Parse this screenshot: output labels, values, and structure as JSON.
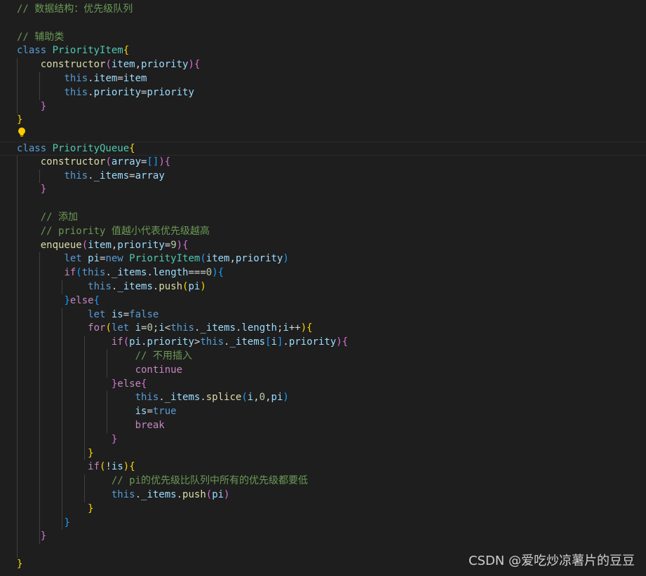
{
  "watermark": "CSDN @爱吃炒凉薯片的豆豆",
  "lines": [
    [
      {
        "t": "// 数据结构：优先级队列",
        "c": "com"
      }
    ],
    [],
    [
      {
        "t": "// 辅助类",
        "c": "com"
      }
    ],
    [
      {
        "t": "class ",
        "c": "kw"
      },
      {
        "t": "PriorityItem",
        "c": "cls"
      },
      {
        "t": "{",
        "c": "b1"
      }
    ],
    [
      {
        "t": "    "
      },
      {
        "t": "constructor",
        "c": "fn"
      },
      {
        "t": "(",
        "c": "b2"
      },
      {
        "t": "item",
        "c": "var"
      },
      {
        "t": ",",
        "c": "op"
      },
      {
        "t": "priority",
        "c": "var"
      },
      {
        "t": ")",
        "c": "b2"
      },
      {
        "t": "{",
        "c": "b2"
      }
    ],
    [
      {
        "t": "        "
      },
      {
        "t": "this",
        "c": "kw"
      },
      {
        "t": ".",
        "c": "op"
      },
      {
        "t": "item",
        "c": "var"
      },
      {
        "t": "=",
        "c": "op"
      },
      {
        "t": "item",
        "c": "var"
      }
    ],
    [
      {
        "t": "        "
      },
      {
        "t": "this",
        "c": "kw"
      },
      {
        "t": ".",
        "c": "op"
      },
      {
        "t": "priority",
        "c": "var"
      },
      {
        "t": "=",
        "c": "op"
      },
      {
        "t": "priority",
        "c": "var"
      }
    ],
    [
      {
        "t": "    "
      },
      {
        "t": "}",
        "c": "b2"
      }
    ],
    [
      {
        "t": "}",
        "c": "b1"
      }
    ],
    [],
    [
      {
        "t": "class ",
        "c": "kw"
      },
      {
        "t": "PriorityQueue",
        "c": "cls"
      },
      {
        "t": "{",
        "c": "b1"
      }
    ],
    [
      {
        "t": "    "
      },
      {
        "t": "constructor",
        "c": "fn"
      },
      {
        "t": "(",
        "c": "b2"
      },
      {
        "t": "array",
        "c": "var"
      },
      {
        "t": "=",
        "c": "op"
      },
      {
        "t": "[]",
        "c": "b3"
      },
      {
        "t": ")",
        "c": "b2"
      },
      {
        "t": "{",
        "c": "b2"
      }
    ],
    [
      {
        "t": "        "
      },
      {
        "t": "this",
        "c": "kw"
      },
      {
        "t": ".",
        "c": "op"
      },
      {
        "t": "_items",
        "c": "var"
      },
      {
        "t": "=",
        "c": "op"
      },
      {
        "t": "array",
        "c": "var"
      }
    ],
    [
      {
        "t": "    "
      },
      {
        "t": "}",
        "c": "b2"
      }
    ],
    [],
    [
      {
        "t": "    "
      },
      {
        "t": "// 添加",
        "c": "com"
      }
    ],
    [
      {
        "t": "    "
      },
      {
        "t": "// priority 值越小代表优先级越高",
        "c": "com"
      }
    ],
    [
      {
        "t": "    "
      },
      {
        "t": "enqueue",
        "c": "fn"
      },
      {
        "t": "(",
        "c": "b2"
      },
      {
        "t": "item",
        "c": "var"
      },
      {
        "t": ",",
        "c": "op"
      },
      {
        "t": "priority",
        "c": "var"
      },
      {
        "t": "=",
        "c": "op"
      },
      {
        "t": "9",
        "c": "num"
      },
      {
        "t": ")",
        "c": "b2"
      },
      {
        "t": "{",
        "c": "b2"
      }
    ],
    [
      {
        "t": "        "
      },
      {
        "t": "let ",
        "c": "kw"
      },
      {
        "t": "pi",
        "c": "var"
      },
      {
        "t": "=",
        "c": "op"
      },
      {
        "t": "new ",
        "c": "kw"
      },
      {
        "t": "PriorityItem",
        "c": "cls"
      },
      {
        "t": "(",
        "c": "b3"
      },
      {
        "t": "item",
        "c": "var"
      },
      {
        "t": ",",
        "c": "op"
      },
      {
        "t": "priority",
        "c": "var"
      },
      {
        "t": ")",
        "c": "b3"
      }
    ],
    [
      {
        "t": "        "
      },
      {
        "t": "if",
        "c": "ctl"
      },
      {
        "t": "(",
        "c": "b3"
      },
      {
        "t": "this",
        "c": "kw"
      },
      {
        "t": ".",
        "c": "op"
      },
      {
        "t": "_items",
        "c": "var"
      },
      {
        "t": ".",
        "c": "op"
      },
      {
        "t": "length",
        "c": "var"
      },
      {
        "t": "===",
        "c": "op"
      },
      {
        "t": "0",
        "c": "num"
      },
      {
        "t": ")",
        "c": "b3"
      },
      {
        "t": "{",
        "c": "b3"
      }
    ],
    [
      {
        "t": "            "
      },
      {
        "t": "this",
        "c": "kw"
      },
      {
        "t": ".",
        "c": "op"
      },
      {
        "t": "_items",
        "c": "var"
      },
      {
        "t": ".",
        "c": "op"
      },
      {
        "t": "push",
        "c": "fn"
      },
      {
        "t": "(",
        "c": "b1"
      },
      {
        "t": "pi",
        "c": "var"
      },
      {
        "t": ")",
        "c": "b1"
      }
    ],
    [
      {
        "t": "        "
      },
      {
        "t": "}",
        "c": "b3"
      },
      {
        "t": "else",
        "c": "ctl"
      },
      {
        "t": "{",
        "c": "b3"
      }
    ],
    [
      {
        "t": "            "
      },
      {
        "t": "let ",
        "c": "kw"
      },
      {
        "t": "is",
        "c": "var"
      },
      {
        "t": "=",
        "c": "op"
      },
      {
        "t": "false",
        "c": "kw"
      }
    ],
    [
      {
        "t": "            "
      },
      {
        "t": "for",
        "c": "ctl"
      },
      {
        "t": "(",
        "c": "b1"
      },
      {
        "t": "let ",
        "c": "kw"
      },
      {
        "t": "i",
        "c": "var"
      },
      {
        "t": "=",
        "c": "op"
      },
      {
        "t": "0",
        "c": "num"
      },
      {
        "t": ";",
        "c": "op"
      },
      {
        "t": "i",
        "c": "var"
      },
      {
        "t": "<",
        "c": "op"
      },
      {
        "t": "this",
        "c": "kw"
      },
      {
        "t": ".",
        "c": "op"
      },
      {
        "t": "_items",
        "c": "var"
      },
      {
        "t": ".",
        "c": "op"
      },
      {
        "t": "length",
        "c": "var"
      },
      {
        "t": ";",
        "c": "op"
      },
      {
        "t": "i",
        "c": "var"
      },
      {
        "t": "++",
        "c": "op"
      },
      {
        "t": ")",
        "c": "b1"
      },
      {
        "t": "{",
        "c": "b1"
      }
    ],
    [
      {
        "t": "                "
      },
      {
        "t": "if",
        "c": "ctl"
      },
      {
        "t": "(",
        "c": "b2"
      },
      {
        "t": "pi",
        "c": "var"
      },
      {
        "t": ".",
        "c": "op"
      },
      {
        "t": "priority",
        "c": "var"
      },
      {
        "t": ">",
        "c": "op"
      },
      {
        "t": "this",
        "c": "kw"
      },
      {
        "t": ".",
        "c": "op"
      },
      {
        "t": "_items",
        "c": "var"
      },
      {
        "t": "[",
        "c": "b3"
      },
      {
        "t": "i",
        "c": "var"
      },
      {
        "t": "]",
        "c": "b3"
      },
      {
        "t": ".",
        "c": "op"
      },
      {
        "t": "priority",
        "c": "var"
      },
      {
        "t": ")",
        "c": "b2"
      },
      {
        "t": "{",
        "c": "b2"
      }
    ],
    [
      {
        "t": "                    "
      },
      {
        "t": "// 不用插入",
        "c": "com"
      }
    ],
    [
      {
        "t": "                    "
      },
      {
        "t": "continue",
        "c": "ctl"
      }
    ],
    [
      {
        "t": "                "
      },
      {
        "t": "}",
        "c": "b2"
      },
      {
        "t": "else",
        "c": "ctl"
      },
      {
        "t": "{",
        "c": "b2"
      }
    ],
    [
      {
        "t": "                    "
      },
      {
        "t": "this",
        "c": "kw"
      },
      {
        "t": ".",
        "c": "op"
      },
      {
        "t": "_items",
        "c": "var"
      },
      {
        "t": ".",
        "c": "op"
      },
      {
        "t": "splice",
        "c": "fn"
      },
      {
        "t": "(",
        "c": "b3"
      },
      {
        "t": "i",
        "c": "var"
      },
      {
        "t": ",",
        "c": "op"
      },
      {
        "t": "0",
        "c": "num"
      },
      {
        "t": ",",
        "c": "op"
      },
      {
        "t": "pi",
        "c": "var"
      },
      {
        "t": ")",
        "c": "b3"
      }
    ],
    [
      {
        "t": "                    "
      },
      {
        "t": "is",
        "c": "var"
      },
      {
        "t": "=",
        "c": "op"
      },
      {
        "t": "true",
        "c": "kw"
      }
    ],
    [
      {
        "t": "                    "
      },
      {
        "t": "break",
        "c": "ctl"
      }
    ],
    [
      {
        "t": "                "
      },
      {
        "t": "}",
        "c": "b2"
      }
    ],
    [
      {
        "t": "            "
      },
      {
        "t": "}",
        "c": "b1"
      }
    ],
    [
      {
        "t": "            "
      },
      {
        "t": "if",
        "c": "ctl"
      },
      {
        "t": "(",
        "c": "b1"
      },
      {
        "t": "!",
        "c": "op"
      },
      {
        "t": "is",
        "c": "var"
      },
      {
        "t": ")",
        "c": "b1"
      },
      {
        "t": "{",
        "c": "b1"
      }
    ],
    [
      {
        "t": "                "
      },
      {
        "t": "// pi的优先级比队列中所有的优先级都要低",
        "c": "com"
      }
    ],
    [
      {
        "t": "                "
      },
      {
        "t": "this",
        "c": "kw"
      },
      {
        "t": ".",
        "c": "op"
      },
      {
        "t": "_items",
        "c": "var"
      },
      {
        "t": ".",
        "c": "op"
      },
      {
        "t": "push",
        "c": "fn"
      },
      {
        "t": "(",
        "c": "b2"
      },
      {
        "t": "pi",
        "c": "var"
      },
      {
        "t": ")",
        "c": "b2"
      }
    ],
    [
      {
        "t": "            "
      },
      {
        "t": "}",
        "c": "b1"
      }
    ],
    [
      {
        "t": "        "
      },
      {
        "t": "}",
        "c": "b3"
      }
    ],
    [
      {
        "t": "    "
      },
      {
        "t": "}",
        "c": "b2"
      }
    ],
    [],
    [
      {
        "t": "}",
        "c": "b1"
      }
    ]
  ]
}
